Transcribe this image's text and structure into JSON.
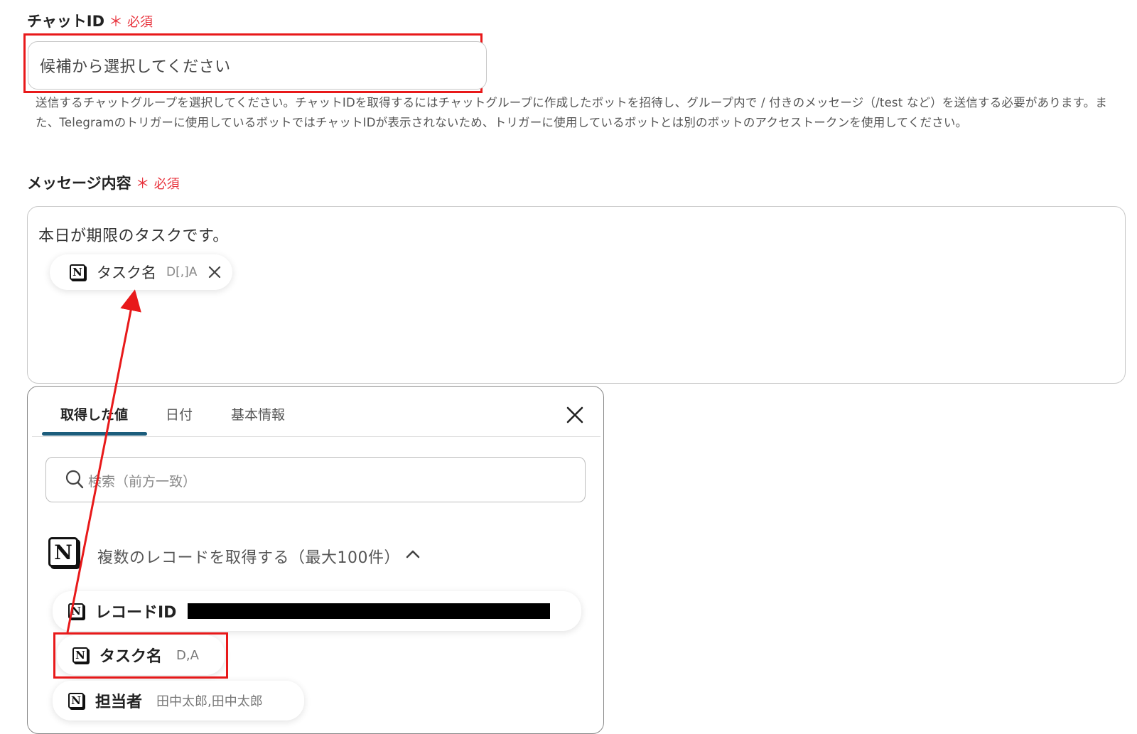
{
  "chat_id_field": {
    "label": "チャットID",
    "required_star": "＊",
    "required_text": "必須",
    "placeholder": "候補から選択してください",
    "help_line1": "送信するチャットグループを選択してください。チャットIDを取得するにはチャットグループに作成したボットを招待し、グループ内で / 付きのメッセージ（/test など）を送信する必要があります。ま",
    "help_line2": "た、Telegramのトリガーに使用しているボットではチャットIDが表示されないため、トリガーに使用しているボットとは別のボットのアクセストークンを使用してください。"
  },
  "message_field": {
    "label": "メッセージ内容",
    "required_star": "＊",
    "required_text": "必須",
    "text": "本日が期限のタスクです。",
    "token": {
      "label": "タスク名",
      "sub": "D[,]A",
      "icon": "notion-icon"
    }
  },
  "picker": {
    "tabs": [
      {
        "label": "取得した値",
        "active": true
      },
      {
        "label": "日付",
        "active": false
      },
      {
        "label": "基本情報",
        "active": false
      }
    ],
    "search_placeholder": "検索（前方一致）",
    "group": {
      "label": "複数のレコードを取得する（最大100件）",
      "icon": "notion-icon",
      "expanded": true
    },
    "items": [
      {
        "label": "レコードID",
        "value": "",
        "redacted": true
      },
      {
        "label": "タスク名",
        "value": "D,A",
        "highlighted": true
      },
      {
        "label": "担当者",
        "value": "田中太郎,田中太郎"
      }
    ]
  },
  "colors": {
    "required": "#e8323c",
    "highlight": "#e8191a",
    "tab_underline": "#1c5d7c"
  }
}
